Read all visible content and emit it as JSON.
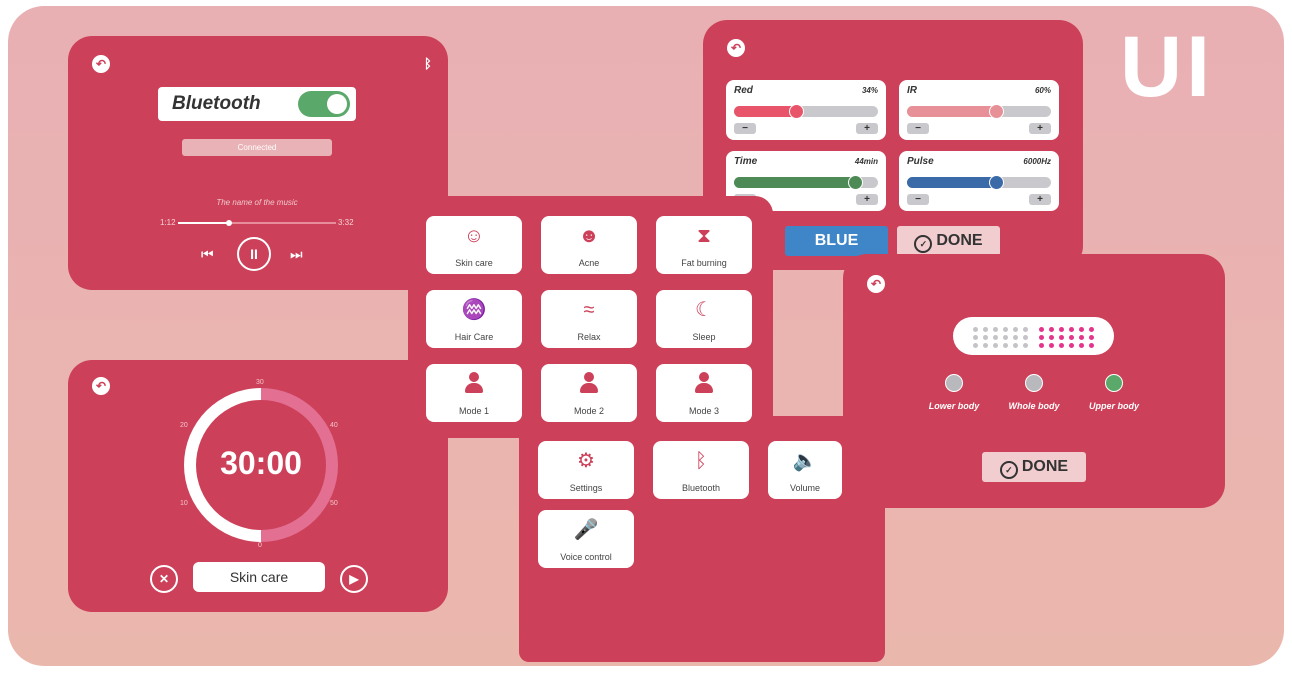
{
  "logo": "UI",
  "bluetooth_panel": {
    "title": "Bluetooth",
    "status": "Connected",
    "music_name": "The name of the music",
    "time_elapsed": "1:12",
    "time_total": "3:32",
    "progress": 0.32,
    "icons": {
      "back": "back-arrow-icon",
      "bluetooth": "bluetooth-icon",
      "prev": "skip-back-icon",
      "pause": "pause-icon",
      "next": "skip-forward-icon"
    }
  },
  "light_panel": {
    "sliders": [
      {
        "label": "Red",
        "value": "34%",
        "level": 0.43,
        "color": "#e8556a"
      },
      {
        "label": "IR",
        "value": "60%",
        "level": 0.62,
        "color": "#e89098"
      },
      {
        "label": "Time",
        "value": "44min",
        "level": 0.84,
        "color": "#4d8a55"
      },
      {
        "label": "Pulse",
        "value": "6000Hz",
        "level": 0.62,
        "color": "#3a6aa8"
      }
    ],
    "blue_label": "BLUE",
    "done_label": "DONE",
    "blue_color": "#3f86c8"
  },
  "modes_panel": {
    "items": [
      {
        "label": "Skin care",
        "icon": "face-care-icon"
      },
      {
        "label": "Acne",
        "icon": "acne-face-icon"
      },
      {
        "label": "Fat burning",
        "icon": "body-shape-icon"
      },
      {
        "label": "Hair Care",
        "icon": "hair-head-icon"
      },
      {
        "label": "Relax",
        "icon": "relax-chair-icon"
      },
      {
        "label": "Sleep",
        "icon": "moon-sleep-icon"
      },
      {
        "label": "Mode 1",
        "icon": "user-icon"
      },
      {
        "label": "Mode 2",
        "icon": "user-icon"
      },
      {
        "label": "Mode 3",
        "icon": "user-icon"
      },
      {
        "label": "Settings",
        "icon": "gear-icon"
      },
      {
        "label": "Bluetooth",
        "icon": "bluetooth-icon"
      },
      {
        "label": "Volume",
        "icon": "speaker-icon"
      },
      {
        "label": "Voice control",
        "icon": "microphone-icon"
      }
    ]
  },
  "timer_panel": {
    "time": "30:00",
    "ticks": [
      "30",
      "40",
      "50",
      "0",
      "10",
      "20"
    ],
    "mode": "Skin care",
    "progress": 0.5,
    "icons": {
      "cancel": "close-icon",
      "play": "play-icon"
    }
  },
  "body_panel": {
    "options": [
      {
        "label": "Lower body",
        "color": "#b9b9bd"
      },
      {
        "label": "Whole body",
        "color": "#b9b9bd"
      },
      {
        "label": "Upper body",
        "color": "#5aa86a"
      }
    ],
    "selected": "Upper body",
    "done_label": "DONE"
  }
}
